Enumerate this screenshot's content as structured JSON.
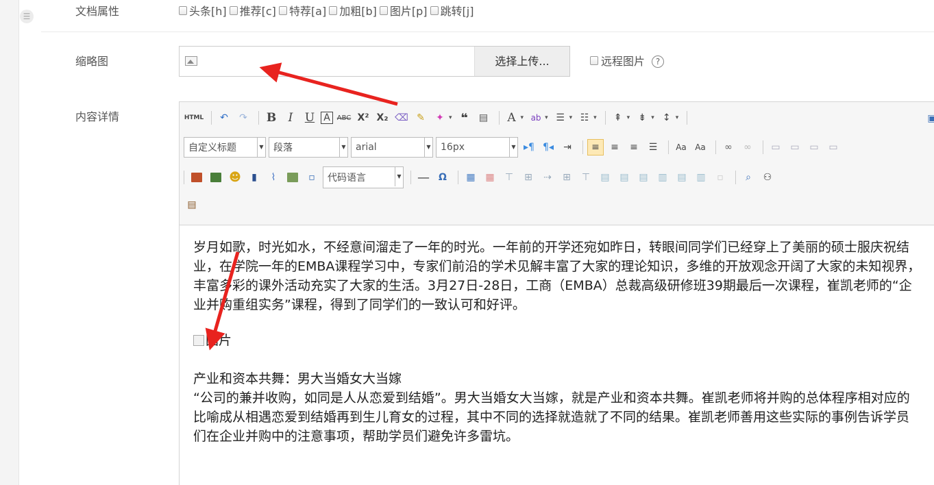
{
  "form": {
    "attributes": {
      "label": "文档属性",
      "options": [
        "头条[h]",
        "推荐[c]",
        "特荐[a]",
        "加粗[b]",
        "图片[p]",
        "跳转[j]"
      ]
    },
    "thumbnail": {
      "label": "缩略图",
      "upload_label": "选择上传...",
      "remote_label": "远程图片",
      "help": "?"
    },
    "content": {
      "label": "内容详情"
    }
  },
  "editor": {
    "toolbar": {
      "html_label": "HTML",
      "custom_heading": "自定义标题",
      "paragraph": "段落",
      "font_family": "arial",
      "font_size": "16px",
      "code_language": "代码语言"
    },
    "body": {
      "paragraph1": "岁月如歌，时光如水，不经意间溜走了一年的时光。一年前的开学还宛如昨日，转眼间同学们已经穿上了美丽的硕士服庆祝结业，在学院一年的EMBA课程学习中，专家们前沿的学术见解丰富了大家的理论知识，多维的开放观念开阔了大家的未知视界，丰富多彩的课外活动充实了大家的生活。3月27日-28日，工商（EMBA）总裁高级研修班39期最后一次课程，崔凯老师的“企业并购重组实务”课程，得到了同学们的一致认可和好评。",
      "image_alt": "图片",
      "subheading": "产业和资本共舞：男大当婚女大当嫁",
      "paragraph2": "“公司的兼并收购，如同是人从恋爱到结婚”。男大当婚女大当嫁，就是产业和资本共舞。崔凯老师将并购的总体程序相对应的比喻成从相遇恋爱到结婚再到生儿育女的过程，其中不同的选择就造就了不同的结果。崔凯老师善用这些实际的事例告诉学员们在企业并购中的注意事项，帮助学员们避免许多雷坑。"
    }
  },
  "colors": {
    "arrow": "#e8231f",
    "active_button": "#fde9b6"
  }
}
